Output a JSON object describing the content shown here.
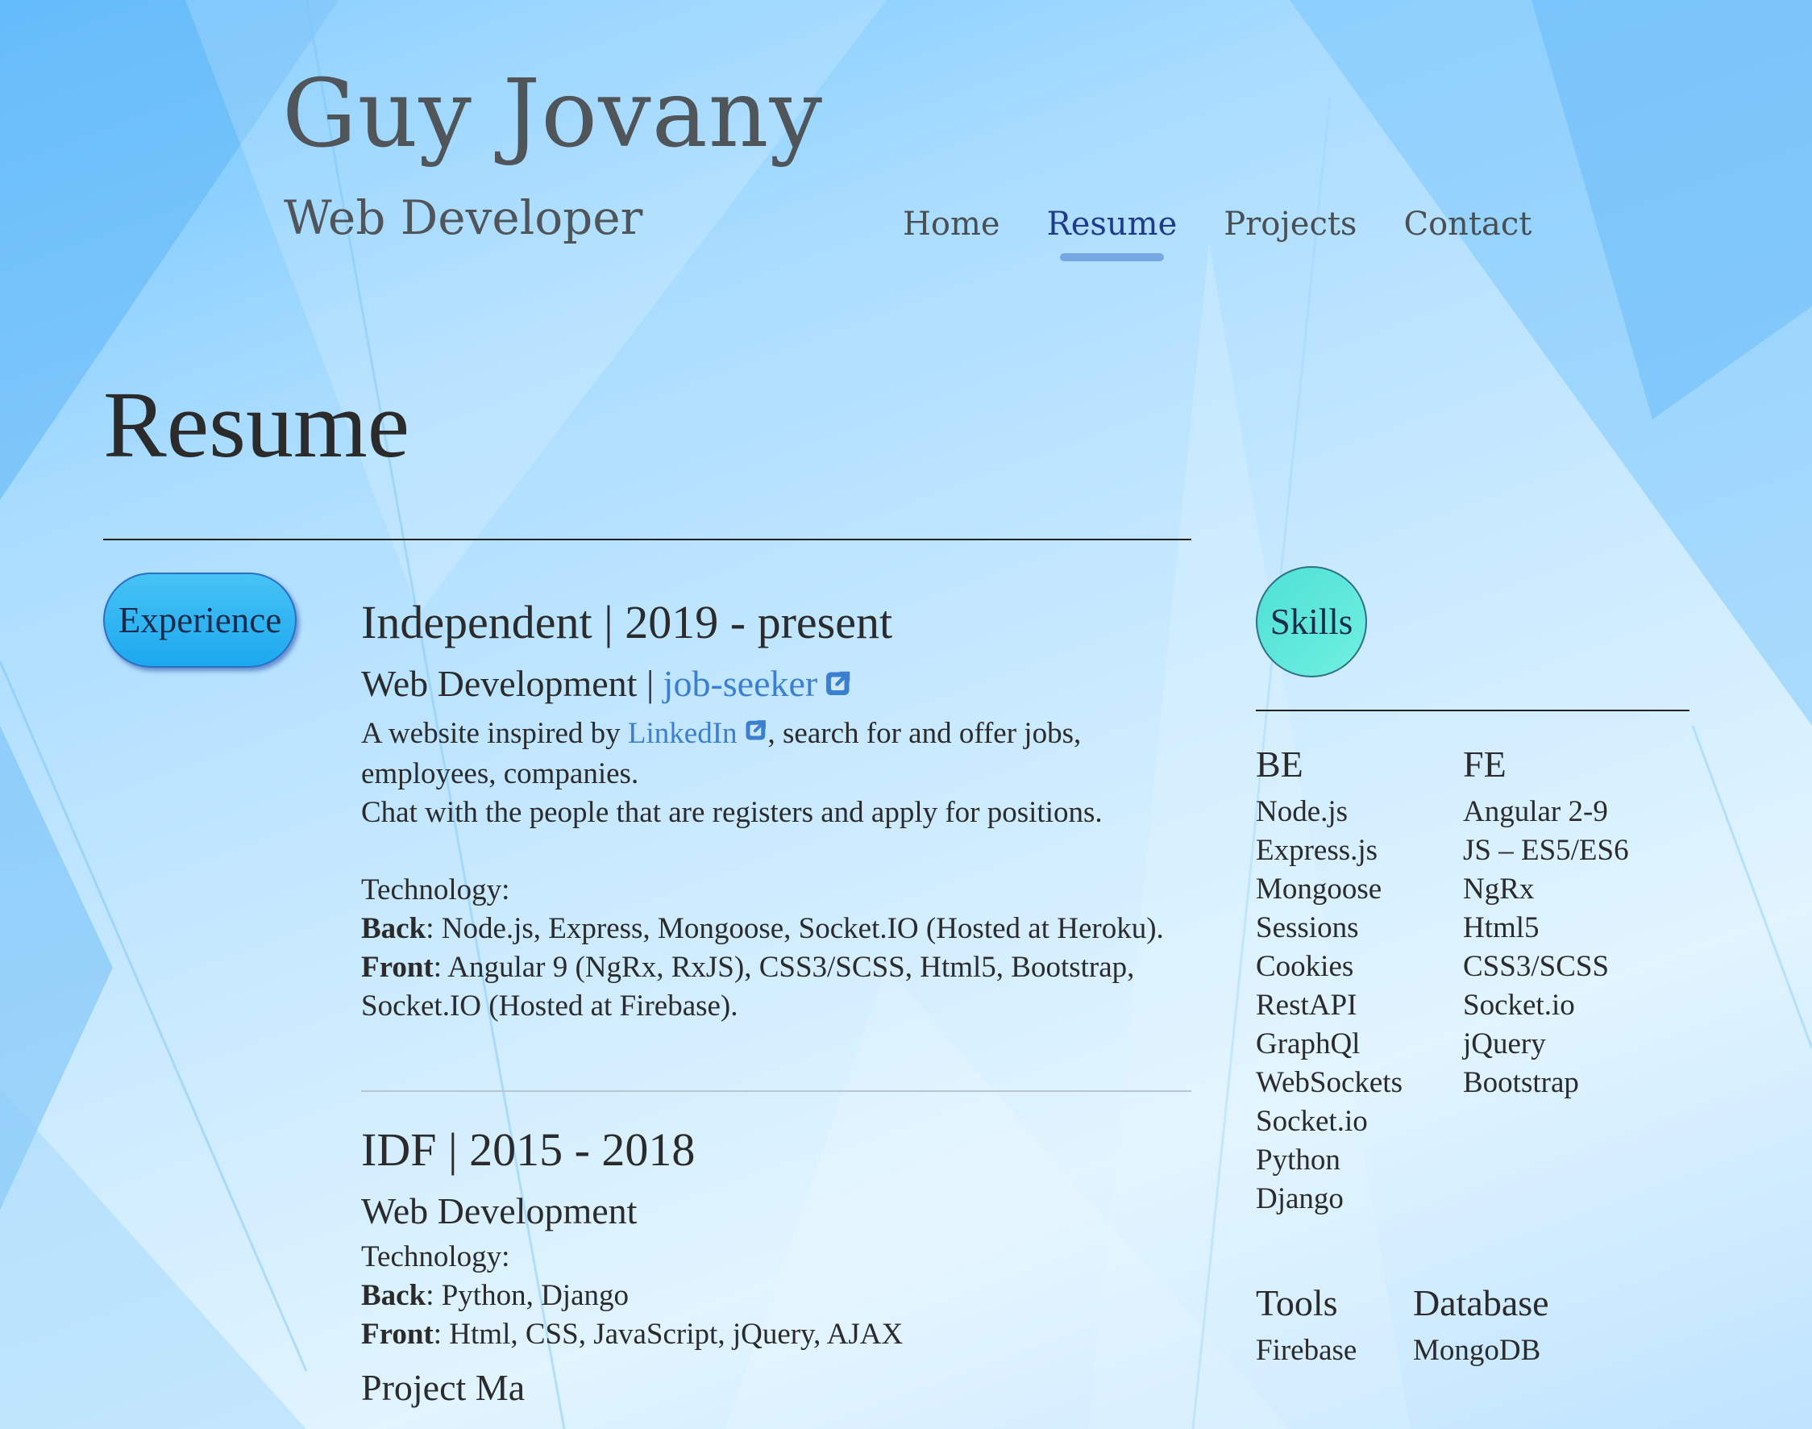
{
  "header": {
    "name": "Guy Jovany",
    "role": "Web Developer",
    "nav": [
      {
        "label": "Home",
        "active": false
      },
      {
        "label": "Resume",
        "active": true
      },
      {
        "label": "Projects",
        "active": false
      },
      {
        "label": "Contact",
        "active": false
      }
    ]
  },
  "page": {
    "title": "Resume"
  },
  "experience": {
    "badge": "Experience",
    "jobs": [
      {
        "heading": "Independent | 2019 - present",
        "sub_prefix": "Web Development | ",
        "sub_link": "job-seeker",
        "desc_before": "A website inspired by ",
        "desc_link": "LinkedIn",
        "desc_after": ", search for and offer jobs, employees, companies.",
        "desc_line2": "Chat with the people that are registers and apply for positions.",
        "tech_label": "Technology:",
        "back_label": "Back",
        "back_text": ": Node.js, Express, Mongoose, Socket.IO (Hosted at Heroku).",
        "front_label": "Front",
        "front_text": ": Angular 9 (NgRx, RxJS), CSS3/SCSS, Html5, Bootstrap, Socket.IO (Hosted at Firebase)."
      },
      {
        "heading": "IDF | 2015 - 2018",
        "sub": "Web Development",
        "tech_label": "Technology:",
        "back_label": "Back",
        "back_text": ": Python, Django",
        "front_label": "Front",
        "front_text": ": Html, CSS, JavaScript, jQuery, AJAX",
        "cut_off_text": "Project Ma"
      }
    ]
  },
  "skills": {
    "badge": "Skills",
    "groups": [
      {
        "title": "BE",
        "items": [
          "Node.js",
          "Express.js",
          "Mongoose",
          "Sessions",
          "Cookies",
          "RestAPI",
          "GraphQl",
          "WebSockets",
          "Socket.io",
          "Python",
          "Django"
        ]
      },
      {
        "title": "FE",
        "items": [
          "Angular 2-9",
          "JS – ES5/ES6",
          "NgRx",
          "Html5",
          "CSS3/SCSS",
          "Socket.io",
          "jQuery",
          "Bootstrap"
        ]
      },
      {
        "title": "Tools",
        "items": [
          "Firebase"
        ]
      },
      {
        "title": "Database",
        "items": [
          "MongoDB"
        ]
      }
    ]
  },
  "colors": {
    "link": "#3a7fd0",
    "nav_active": "#1f3a8a",
    "experience_badge": "#1ca8ef",
    "skills_badge": "#5ee8da"
  },
  "icons": [
    "external-link-icon"
  ]
}
